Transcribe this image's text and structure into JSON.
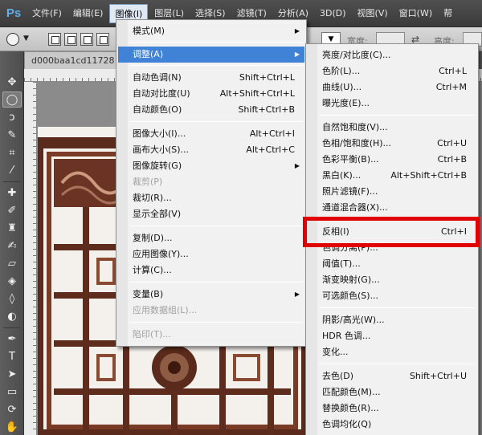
{
  "menubar": {
    "logo": "Ps",
    "items": [
      "文件(F)",
      "编辑(E)",
      "图像(I)",
      "图层(L)",
      "选择(S)",
      "滤镜(T)",
      "分析(A)",
      "3D(D)",
      "视图(V)",
      "窗口(W)",
      "帮"
    ]
  },
  "options": {
    "width_label": "宽度:",
    "height_label": "高度:",
    "swap_glyph": "⇄"
  },
  "document": {
    "tab_title": "d000baa1cd11728"
  },
  "image_menu": {
    "items": [
      {
        "label": "模式(M)",
        "shortcut": "",
        "submenu": true,
        "disabled": false
      },
      {
        "label": "调整(A)",
        "shortcut": "",
        "submenu": true,
        "disabled": false
      },
      {
        "label": "自动色调(N)",
        "shortcut": "Shift+Ctrl+L",
        "submenu": false,
        "disabled": false
      },
      {
        "label": "自动对比度(U)",
        "shortcut": "Alt+Shift+Ctrl+L",
        "submenu": false,
        "disabled": false
      },
      {
        "label": "自动颜色(O)",
        "shortcut": "Shift+Ctrl+B",
        "submenu": false,
        "disabled": false
      },
      {
        "label": "图像大小(I)...",
        "shortcut": "Alt+Ctrl+I",
        "submenu": false,
        "disabled": false
      },
      {
        "label": "画布大小(S)...",
        "shortcut": "Alt+Ctrl+C",
        "submenu": false,
        "disabled": false
      },
      {
        "label": "图像旋转(G)",
        "shortcut": "",
        "submenu": true,
        "disabled": false
      },
      {
        "label": "裁剪(P)",
        "shortcut": "",
        "submenu": false,
        "disabled": true
      },
      {
        "label": "裁切(R)...",
        "shortcut": "",
        "submenu": false,
        "disabled": false
      },
      {
        "label": "显示全部(V)",
        "shortcut": "",
        "submenu": false,
        "disabled": false
      },
      {
        "label": "复制(D)...",
        "shortcut": "",
        "submenu": false,
        "disabled": false
      },
      {
        "label": "应用图像(Y)...",
        "shortcut": "",
        "submenu": false,
        "disabled": false
      },
      {
        "label": "计算(C)...",
        "shortcut": "",
        "submenu": false,
        "disabled": false
      },
      {
        "label": "变量(B)",
        "shortcut": "",
        "submenu": true,
        "disabled": false
      },
      {
        "label": "应用数据组(L)...",
        "shortcut": "",
        "submenu": false,
        "disabled": true
      },
      {
        "label": "陷印(T)...",
        "shortcut": "",
        "submenu": false,
        "disabled": true
      }
    ]
  },
  "adjust_menu": {
    "items": [
      {
        "label": "亮度/对比度(C)...",
        "shortcut": ""
      },
      {
        "label": "色阶(L)...",
        "shortcut": "Ctrl+L"
      },
      {
        "label": "曲线(U)...",
        "shortcut": "Ctrl+M"
      },
      {
        "label": "曝光度(E)...",
        "shortcut": ""
      },
      {
        "label": "自然饱和度(V)...",
        "shortcut": ""
      },
      {
        "label": "色相/饱和度(H)...",
        "shortcut": "Ctrl+U"
      },
      {
        "label": "色彩平衡(B)...",
        "shortcut": "Ctrl+B"
      },
      {
        "label": "黑白(K)...",
        "shortcut": "Alt+Shift+Ctrl+B"
      },
      {
        "label": "照片滤镜(F)...",
        "shortcut": ""
      },
      {
        "label": "通道混合器(X)...",
        "shortcut": ""
      },
      {
        "label": "反相(I)",
        "shortcut": "Ctrl+I"
      },
      {
        "label": "色调分离(P)...",
        "shortcut": ""
      },
      {
        "label": "阈值(T)...",
        "shortcut": ""
      },
      {
        "label": "渐变映射(G)...",
        "shortcut": ""
      },
      {
        "label": "可选颜色(S)...",
        "shortcut": ""
      },
      {
        "label": "阴影/高光(W)...",
        "shortcut": ""
      },
      {
        "label": "HDR 色调...",
        "shortcut": ""
      },
      {
        "label": "变化...",
        "shortcut": ""
      },
      {
        "label": "去色(D)",
        "shortcut": "Shift+Ctrl+U"
      },
      {
        "label": "匹配颜色(M)...",
        "shortcut": ""
      },
      {
        "label": "替换颜色(R)...",
        "shortcut": ""
      },
      {
        "label": "色调均化(Q)",
        "shortcut": ""
      }
    ]
  },
  "colors": {
    "highlight": "#3f82d6",
    "annotation_box": "#e00000"
  }
}
